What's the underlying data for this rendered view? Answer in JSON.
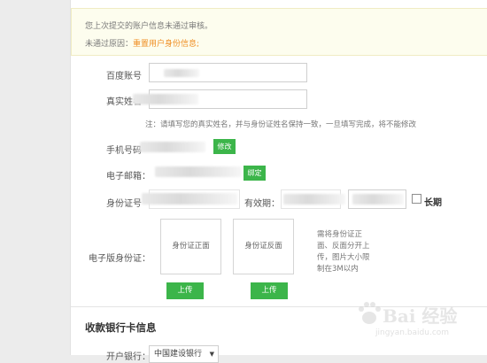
{
  "notice": {
    "title": "您上次提交的账户信息未通过审核。",
    "reason_prefix": "未通过原因：",
    "reason_link": "重置用户身份信息;"
  },
  "form": {
    "account_label": "百度账号",
    "name_label": "真实姓名",
    "name_note": "注：请填写您的真实姓名，并与身份证姓名保持一致，一旦填写完成，将不能修改",
    "phone_label": "手机号码",
    "phone_button": "修改",
    "email_label": "电子邮箱：",
    "email_button": "绑定",
    "id_label": "身份证号",
    "validity_label": "有效期：",
    "longterm_label": "长期",
    "longterm_checked": false,
    "eid_label": "电子版身份证：",
    "id_front_label": "身份证正面",
    "id_back_label": "身份证反面",
    "upload_front": "上传",
    "upload_back": "上传",
    "upload_hint": "需将身份证正面、反面分开上传，图片大小限制在3M以内"
  },
  "bank": {
    "section_title": "收款银行卡信息",
    "open_bank_label": "开户银行：",
    "open_bank_value": "中国建设银行"
  },
  "watermark": {
    "text": "Bai 经验",
    "url": "jingyan.baidu.com"
  },
  "colors": {
    "accent_green": "#3cb54a",
    "link_orange": "#f08f24",
    "notice_bg": "#fdfdee"
  }
}
